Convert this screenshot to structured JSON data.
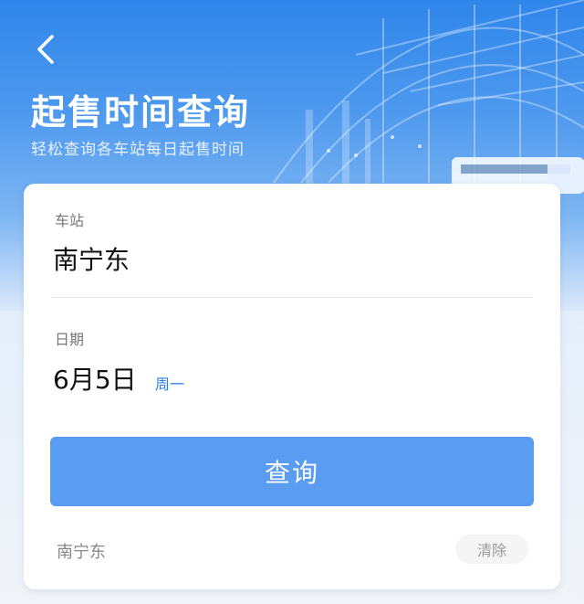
{
  "header": {
    "title": "起售时间查询",
    "subtitle": "轻松查询各车站每日起售时间"
  },
  "form": {
    "station": {
      "label": "车站",
      "value": "南宁东"
    },
    "date": {
      "label": "日期",
      "value": "6月5日",
      "weekday": "周一"
    },
    "query_label": "查询"
  },
  "history": {
    "items": [
      "南宁东"
    ],
    "clear_label": "清除"
  },
  "colors": {
    "accent": "#5b9cf3",
    "weekday": "#2b7de9",
    "header": "#2f86ea"
  },
  "icons": {
    "back": "back-chevron-icon"
  }
}
